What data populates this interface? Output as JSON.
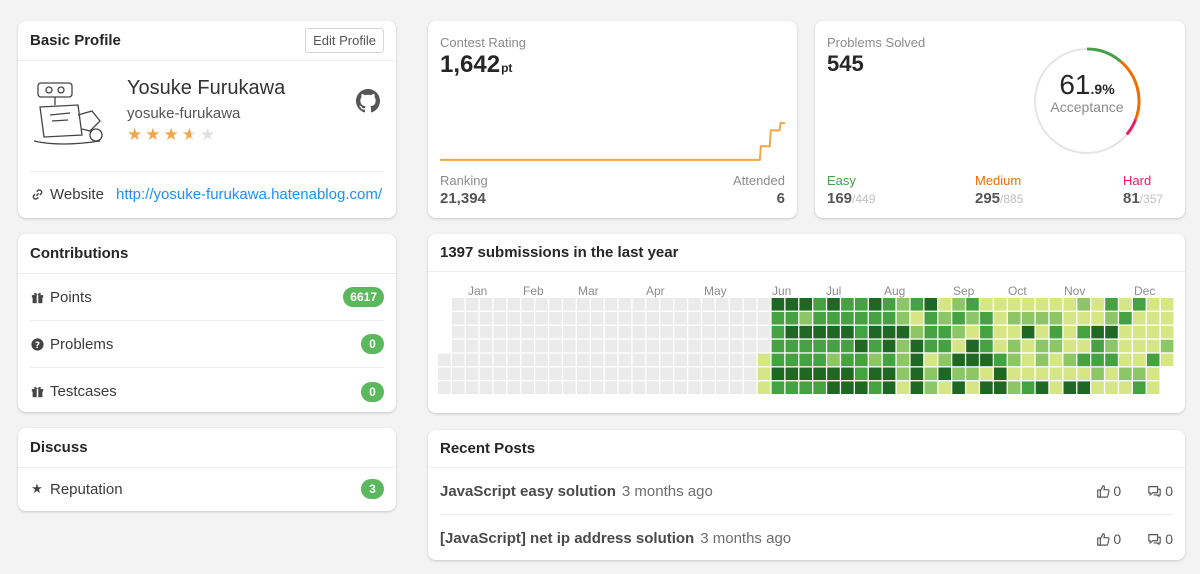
{
  "profile": {
    "header": "Basic Profile",
    "edit_label": "Edit Profile",
    "name": "Yosuke Furukawa",
    "username": "yosuke-furukawa",
    "stars": 3.5,
    "website_label": "Website",
    "website_url": "http://yosuke-furukawa.hatenablog.com/"
  },
  "contributions": {
    "header": "Contributions",
    "items": [
      {
        "label": "Points",
        "value": "6617",
        "icon": "gift-icon"
      },
      {
        "label": "Problems",
        "value": "0",
        "icon": "question-circle-icon"
      },
      {
        "label": "Testcases",
        "value": "0",
        "icon": "gift-icon"
      }
    ]
  },
  "discuss": {
    "header": "Discuss",
    "items": [
      {
        "label": "Reputation",
        "value": "3",
        "icon": "star-icon"
      }
    ]
  },
  "contest": {
    "label": "Contest Rating",
    "rating": "1,642",
    "unit": "pt",
    "ranking_label": "Ranking",
    "ranking": "21,394",
    "attended_label": "Attended",
    "attended": "6",
    "line_color": "#f0a64a",
    "trend": [
      1480,
      1480,
      1480,
      1480,
      1480,
      1480,
      1480,
      1480,
      1480,
      1480,
      1480,
      1480,
      1480,
      1480,
      1480,
      1480,
      1480,
      1480,
      1480,
      1480,
      1480,
      1480,
      1480,
      1480,
      1480,
      1480,
      1480,
      1480,
      1480,
      1480,
      1480,
      1480,
      1480,
      1480,
      1480,
      1480,
      1480,
      1480,
      1480,
      1480,
      1480,
      1480,
      1480,
      1480,
      1480,
      1480,
      1480,
      1480,
      1480,
      1480,
      1480,
      1480,
      1480,
      1480,
      1480,
      1480,
      1480,
      1480,
      1480,
      1480,
      1480,
      1480,
      1480,
      1480,
      1480,
      1480,
      1480,
      1480,
      1480,
      1480,
      1480,
      1480,
      1480,
      1480,
      1480,
      1480,
      1480,
      1480,
      1480,
      1480,
      1480,
      1480,
      1480,
      1480,
      1480,
      1480,
      1480,
      1480,
      1480,
      1480,
      1480,
      1480,
      1480,
      1480,
      1480,
      1480,
      1480,
      1480,
      1480,
      1480,
      1480,
      1480,
      1480,
      1480,
      1480,
      1480,
      1480,
      1480,
      1480,
      1480,
      1480,
      1480,
      1480,
      1480,
      1480,
      1480,
      1480,
      1480,
      1480,
      1480,
      1480,
      1480,
      1480,
      1480,
      1480,
      1480,
      1480,
      1480,
      1480,
      1480,
      1480,
      1480,
      1480,
      1480,
      1480,
      1480,
      1480,
      1480,
      1480,
      1480,
      1480,
      1480,
      1480,
      1480,
      1480,
      1480,
      1480,
      1480,
      1480,
      1480,
      1480,
      1480,
      1480,
      1480,
      1480,
      1480,
      1480,
      1480,
      1480,
      1480,
      1480,
      1480,
      1480,
      1480,
      1480,
      1480,
      1480,
      1480,
      1480,
      1480,
      1480,
      1480,
      1480,
      1480,
      1480,
      1480,
      1480,
      1480,
      1480,
      1480,
      1480,
      1480,
      1480,
      1480,
      1480,
      1480,
      1480,
      1480,
      1480,
      1480,
      1480,
      1480,
      1480,
      1480,
      1480,
      1480,
      1480,
      1480,
      1480,
      1480,
      1480,
      1480,
      1480,
      1480,
      1480,
      1480,
      1480,
      1480,
      1480,
      1480,
      1480,
      1480,
      1480,
      1480,
      1480,
      1480,
      1480,
      1480,
      1480,
      1480,
      1480,
      1480,
      1480,
      1480,
      1480,
      1480,
      1480,
      1480,
      1480,
      1480,
      1480,
      1480,
      1480,
      1480,
      1480,
      1480,
      1480,
      1480,
      1480,
      1480,
      1480,
      1480,
      1480,
      1480,
      1480,
      1480,
      1480,
      1480,
      1480,
      1480,
      1480,
      1480,
      1480,
      1480,
      1480,
      1480,
      1480,
      1480,
      1480,
      1480,
      1480,
      1480,
      1480,
      1480,
      1480,
      1480,
      1480,
      1480,
      1480,
      1480,
      1480,
      1480,
      1480,
      1480,
      1480,
      1480,
      1480,
      1480,
      1480,
      1480,
      1480,
      1480,
      1480,
      1480,
      1480,
      1480,
      1480,
      1480,
      1480,
      1480,
      1480,
      1480,
      1480,
      1540,
      1540,
      1540,
      1540,
      1540,
      1540,
      1540,
      1540,
      1540,
      1610,
      1610,
      1610,
      1610,
      1610,
      1610,
      1610,
      1610,
      1610,
      1642,
      1642,
      1642,
      1642,
      1642
    ]
  },
  "problems": {
    "label": "Problems Solved",
    "solved": "545",
    "acceptance_int": "61",
    "acceptance_dec": ".9%",
    "acceptance_label": "Acceptance",
    "acceptance": 61.9,
    "easy_label": "Easy",
    "easy_solved": "169",
    "easy_total": "/449",
    "easy_color": "#43a047",
    "medium_label": "Medium",
    "medium_solved": "295",
    "medium_total": "/885",
    "medium_color": "#ef6c00",
    "hard_label": "Hard",
    "hard_solved": "81",
    "hard_total": "/357",
    "hard_color": "#e91e63",
    "easy_count": 169,
    "medium_count": 295,
    "hard_count": 81
  },
  "heatmap": {
    "title": "1397 submissions in the last year",
    "months": [
      "Jan",
      "Feb",
      "Mar",
      "Apr",
      "May",
      "Jun",
      "Jul",
      "Aug",
      "Sep",
      "Oct",
      "Nov",
      "Dec"
    ],
    "colors": [
      "#ebebeb",
      "#d6e685",
      "#8cc665",
      "#44a340",
      "#1e6823"
    ]
  },
  "posts": {
    "header": "Recent Posts",
    "items": [
      {
        "title": "JavaScript easy solution",
        "time": "3 months ago",
        "votes": "0",
        "comments": "0"
      },
      {
        "title": "[JavaScript] net ip address solution",
        "time": "3 months ago",
        "votes": "0",
        "comments": "0"
      }
    ]
  }
}
